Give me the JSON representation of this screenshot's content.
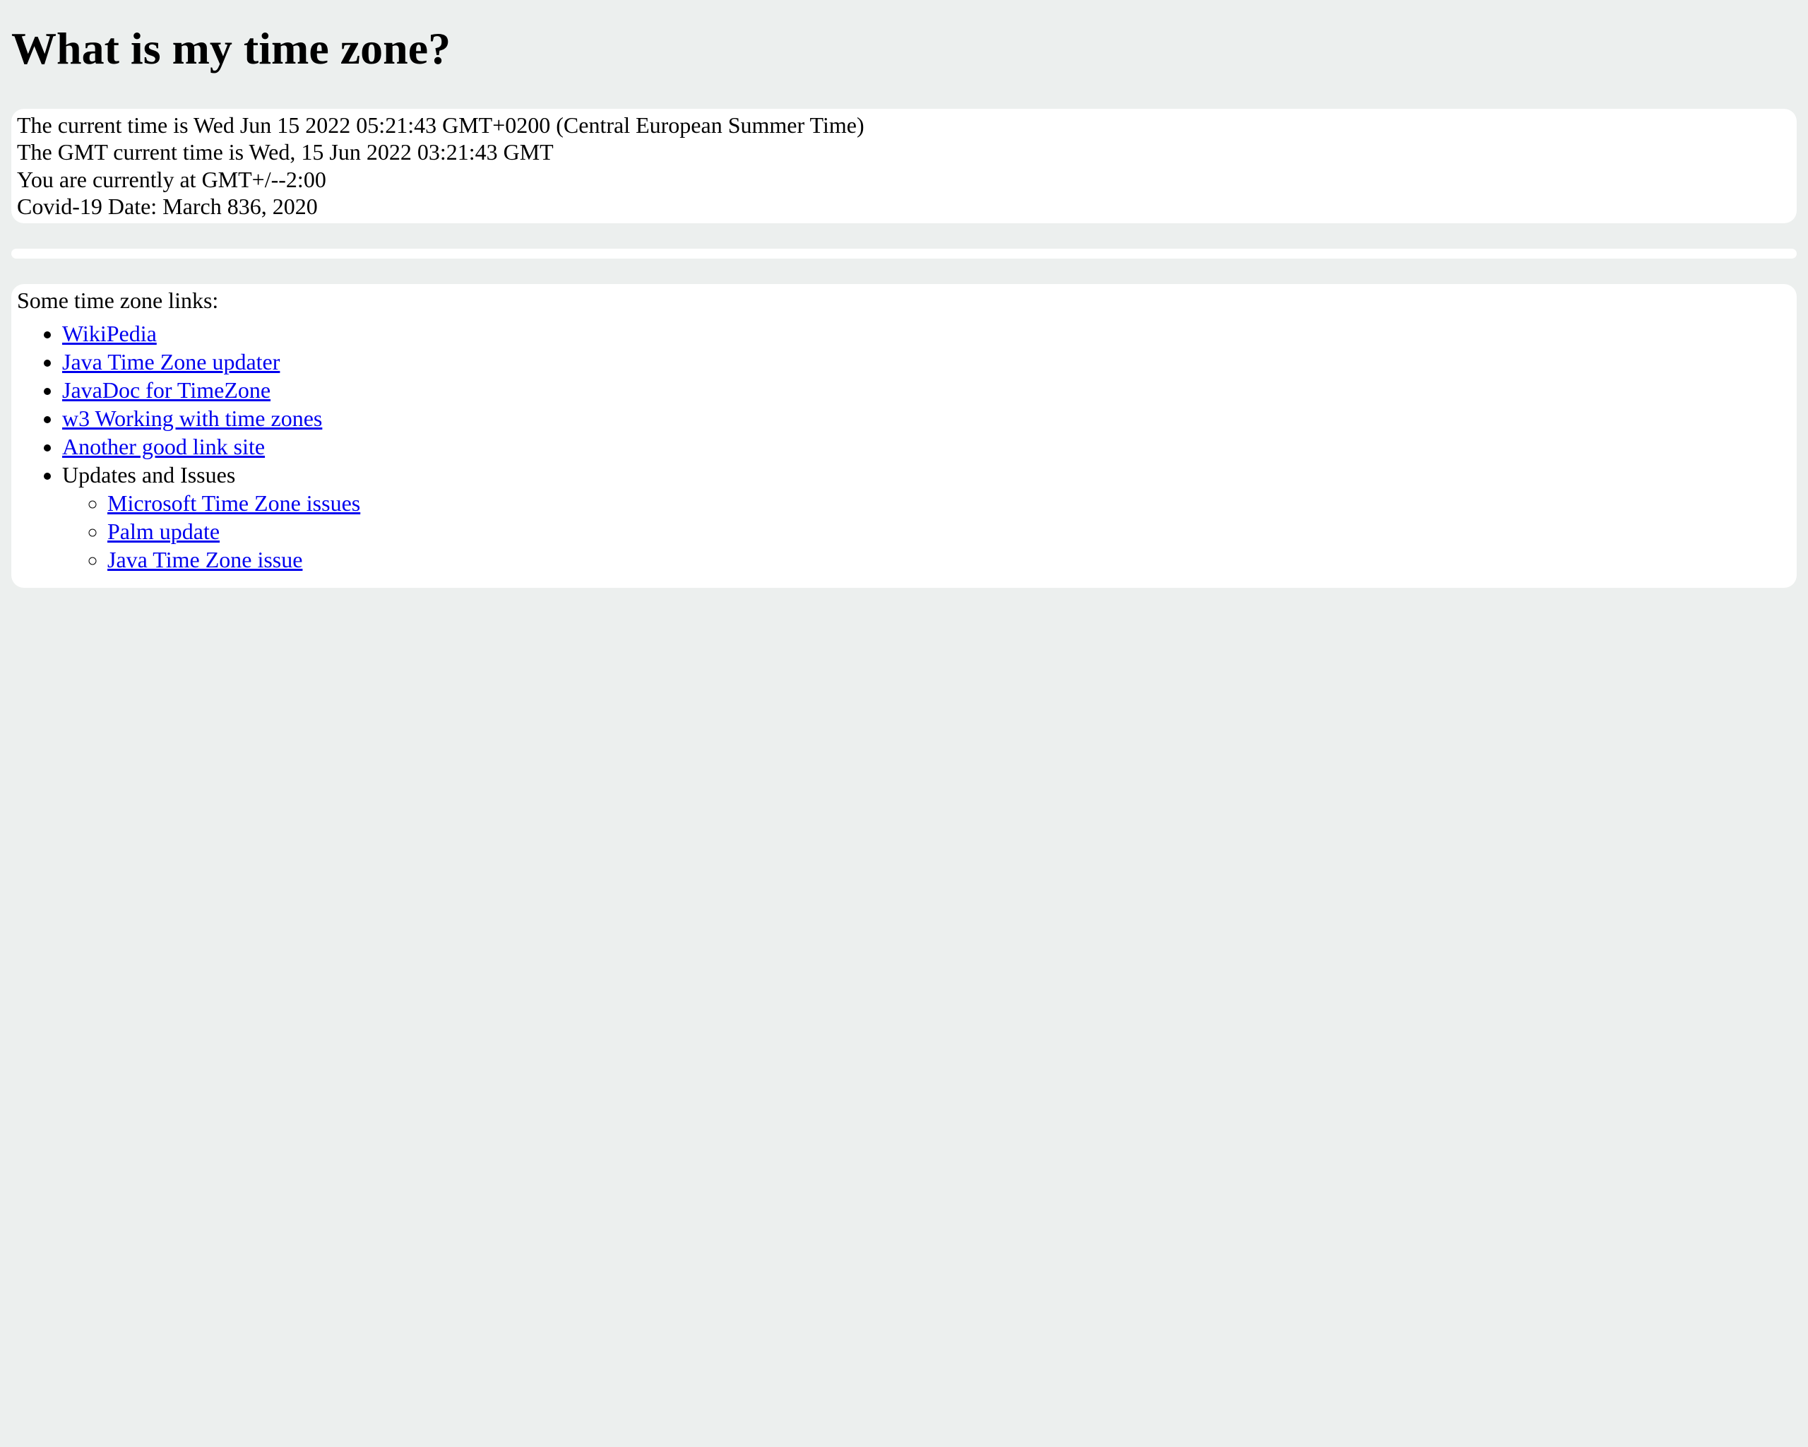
{
  "heading": "What is my time zone?",
  "time_info": {
    "line1": "The current time is Wed Jun 15 2022 05:21:43 GMT+0200 (Central European Summer Time)",
    "line2": "The GMT current time is Wed, 15 Jun 2022 03:21:43 GMT",
    "line3": "You are currently at GMT+/--2:00",
    "line4": "Covid-19 Date: March 836, 2020"
  },
  "links": {
    "intro": "Some time zone links:",
    "items": [
      "WikiPedia",
      "Java Time Zone updater",
      "JavaDoc for TimeZone",
      "w3 Working with time zones",
      "Another good link site"
    ],
    "updates_label": "Updates and Issues",
    "sub_items": [
      "Microsoft Time Zone issues",
      "Palm update",
      "Java Time Zone issue"
    ]
  }
}
